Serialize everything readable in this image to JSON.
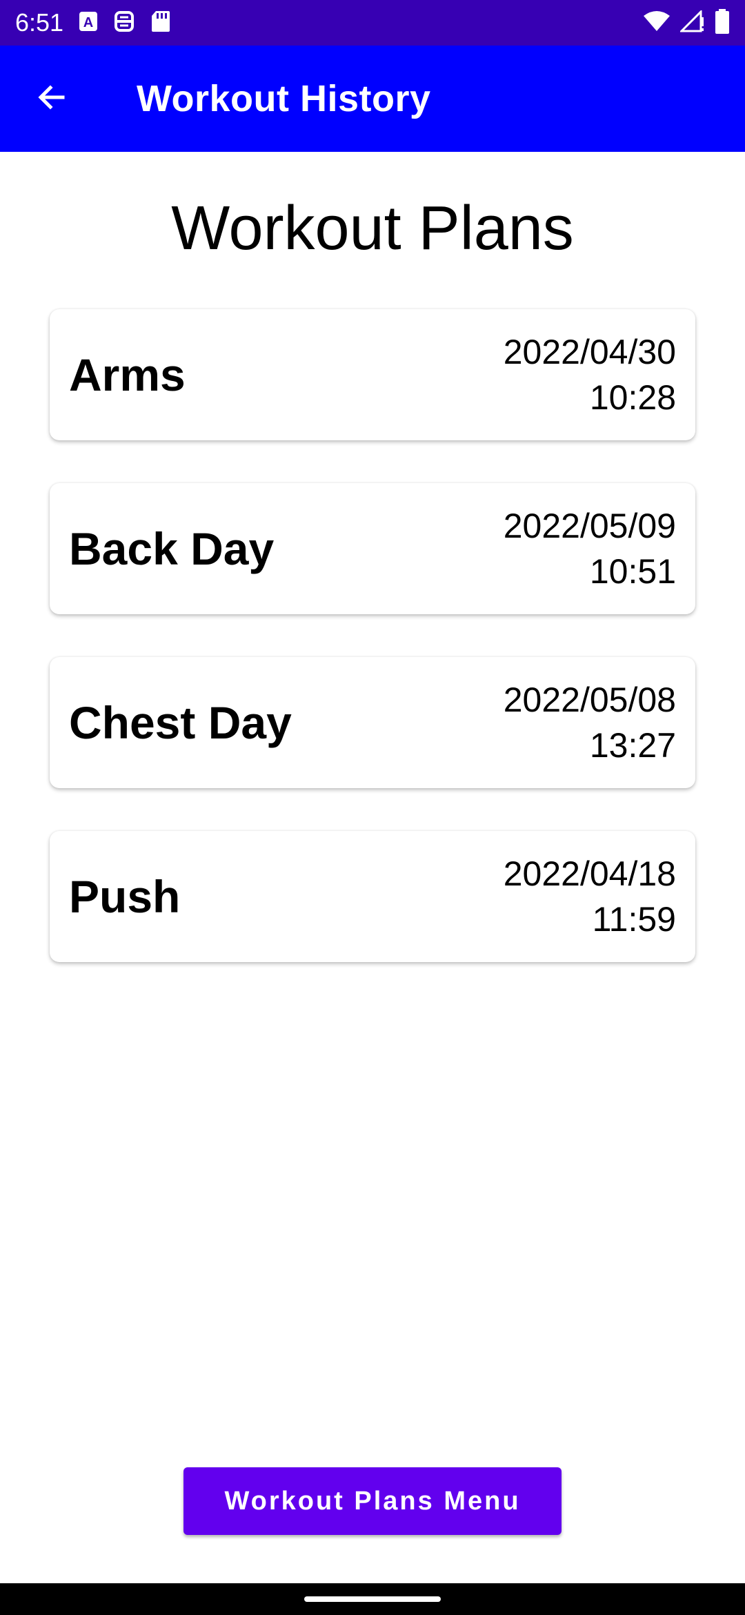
{
  "status_bar": {
    "time": "6:51",
    "left_icons": [
      "text-a-icon",
      "cast-icon",
      "sd-card-icon"
    ],
    "right_icons": [
      "wifi-icon",
      "signal-icon",
      "battery-icon"
    ]
  },
  "app_bar": {
    "title": "Workout History",
    "back_icon": "arrow-back-icon",
    "color": "#0000ff"
  },
  "heading": "Workout Plans",
  "plans": [
    {
      "name": "Arms",
      "date": "2022/04/30",
      "time": "10:28"
    },
    {
      "name": "Back Day",
      "date": "2022/05/09",
      "time": "10:51"
    },
    {
      "name": "Chest Day",
      "date": "2022/05/08",
      "time": "13:27"
    },
    {
      "name": "Push",
      "date": "2022/04/18",
      "time": "11:59"
    }
  ],
  "bottom_button": {
    "label": "Workout Plans Menu",
    "color": "#6200ee"
  },
  "colors": {
    "status_bar": "#3700b3",
    "accent": "#6200ee"
  }
}
